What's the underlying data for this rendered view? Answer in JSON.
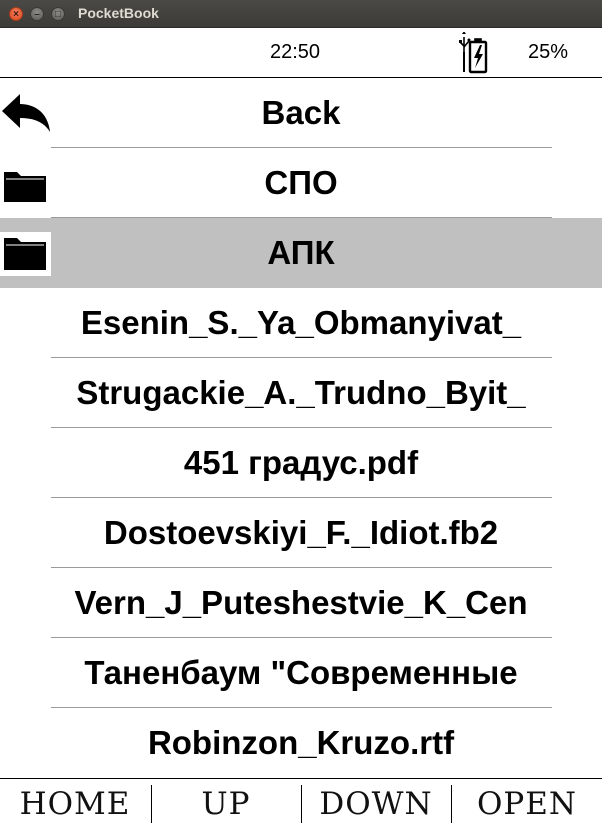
{
  "window": {
    "title": "PocketBook"
  },
  "status": {
    "time": "22:50",
    "battery": "25%",
    "icon": "usb-charging-battery-icon"
  },
  "items": [
    {
      "label": "Back",
      "icon": "back-arrow-icon",
      "selected": false
    },
    {
      "label": "СПО",
      "icon": "folder-icon",
      "selected": false
    },
    {
      "label": "АПК",
      "icon": "folder-icon",
      "selected": true
    },
    {
      "label": "Esenin_S._Ya_Obmanyivat_",
      "icon": "",
      "selected": false
    },
    {
      "label": "Strugackie_A._Trudno_Byit_",
      "icon": "",
      "selected": false
    },
    {
      "label": "451 градус.pdf",
      "icon": "",
      "selected": false
    },
    {
      "label": "Dostoevskiyi_F._Idiot.fb2",
      "icon": "",
      "selected": false
    },
    {
      "label": "Vern_J_Puteshestvie_K_Cen",
      "icon": "",
      "selected": false
    },
    {
      "label": "Таненбаум \"Современные",
      "icon": "",
      "selected": false
    },
    {
      "label": "Robinzon_Kruzo.rtf",
      "icon": "",
      "selected": false
    }
  ],
  "keys": {
    "home": "HOME",
    "up": "UP",
    "down": "DOWN",
    "open": "OPEN"
  }
}
